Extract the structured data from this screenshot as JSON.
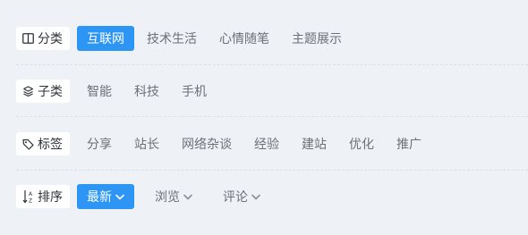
{
  "filters": {
    "category": {
      "label": "分类",
      "icon": "book-open-icon",
      "options": [
        "互联网",
        "技术生活",
        "心情随笔",
        "主题展示"
      ],
      "selected": "互联网"
    },
    "subcategory": {
      "label": "子类",
      "icon": "layers-icon",
      "options": [
        "智能",
        "科技",
        "手机"
      ]
    },
    "tags": {
      "label": "标签",
      "icon": "tag-icon",
      "options": [
        "分享",
        "站长",
        "网络杂谈",
        "经验",
        "建站",
        "优化",
        "推广"
      ]
    },
    "sort": {
      "label": "排序",
      "icon": "sort-az-icon",
      "options": [
        "最新",
        "浏览",
        "评论"
      ],
      "selected": "最新",
      "option_icon": "chevron-down-icon"
    }
  },
  "colors": {
    "accent": "#2d96f5",
    "background": "#eef1f6",
    "label_bg": "#ffffff"
  }
}
